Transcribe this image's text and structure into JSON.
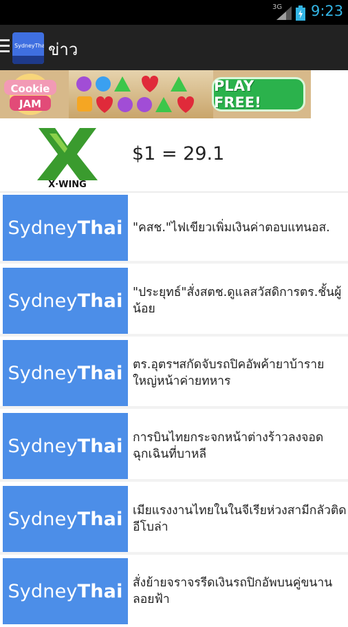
{
  "status": {
    "signal_label": "3G",
    "time": "9:23"
  },
  "action_bar": {
    "app_icon_text": "SydneyThai",
    "title": "ข่าว"
  },
  "ad": {
    "brand": "Cookie JAM",
    "cta": "PLAY FREE!"
  },
  "currency": {
    "logo_text": "X·WING",
    "rate": "$1 = 29.1"
  },
  "news": {
    "thumb_regular": "Sydney",
    "thumb_bold": "Thai",
    "items": [
      {
        "headline": "\"คสช.\"ไฟเขียวเพิ่มเงินค่าตอบแทนอส."
      },
      {
        "headline": "\"ประยุทธ์\"สั่งสตช.ดูแลสวัสดิการตร.ชั้นผู้น้อย"
      },
      {
        "headline": "ตร.อุตรฯสกัดจับรถปิคอัพค้ายาบ้ารายใหญ่หน้าค่ายทหาร"
      },
      {
        "headline": "การบินไทยกระจกหน้าต่างร้าวลงจอดฉุกเฉินที่บาหลี"
      },
      {
        "headline": "เมียแรงงานไทยในในจีเรียห่วงสามีกลัวติดอีโบล่า"
      },
      {
        "headline": "สั่งย้ายจราจรรีดเงินรถปิกอัพบนคู่ขนานลอยฟ้า"
      }
    ]
  },
  "colors": {
    "status_bar": "#000000",
    "action_bar": "#222222",
    "clock": "#33b5e5",
    "thumb": "#4c8ee8",
    "play_button": "#2bb24c",
    "xwing_green": "#3a9b2e"
  }
}
